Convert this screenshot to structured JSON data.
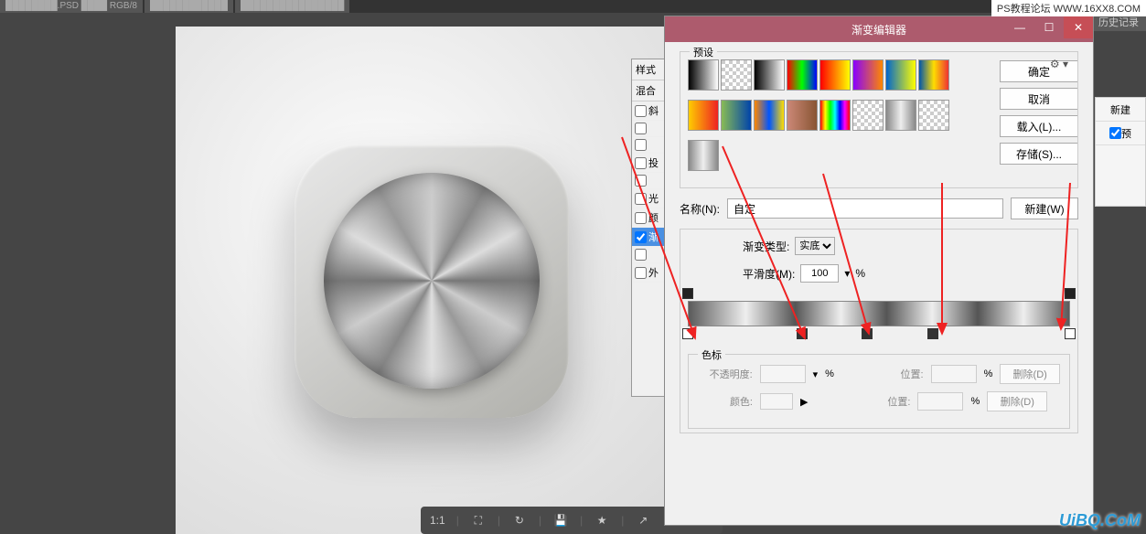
{
  "watermark_top": "PS教程论坛  WWW.16XX8.COM",
  "brand_watermark": "UiBQ.CoM",
  "history_tab": "历史记录",
  "swatch_colors": [
    "#b52f2f",
    "#e83a9a",
    "#7dc93a"
  ],
  "styles_panel": {
    "hdr1": "样式",
    "hdr2": "混合",
    "items": [
      "斜",
      "",
      "",
      "投",
      "",
      "光",
      "颜",
      "渐",
      "",
      "外"
    ],
    "active_index": 7
  },
  "editor": {
    "title": "渐变编辑器",
    "presets_legend": "预设",
    "buttons": {
      "ok": "确定",
      "cancel": "取消",
      "load": "载入(L)...",
      "save": "存储(S)..."
    },
    "name_label": "名称(N):",
    "name_value": "自定",
    "new_btn": "新建(W)",
    "type_label": "渐变类型:",
    "type_value": "实底",
    "smooth_label": "平滑度(M):",
    "smooth_value": "100",
    "smooth_unit": "%",
    "color_stop": {
      "legend": "色标",
      "opacity_label": "不透明度:",
      "opacity_unit": "%",
      "position_label": "位置:",
      "position_unit": "%",
      "delete_btn": "删除(D)",
      "color_label": "颜色:"
    },
    "preset_styles": [
      "linear-gradient(90deg,#000,#fff)",
      "repeating-conic-gradient(#ccc 0 25%,#fff 0 50%) 0/8px 8px",
      "linear-gradient(90deg,#000,#fff)",
      "linear-gradient(90deg,#f00,#0f0,#00f)",
      "linear-gradient(90deg,#f00,#ff0)",
      "linear-gradient(90deg,#80f,#f80)",
      "linear-gradient(90deg,#06c,#ff0)",
      "linear-gradient(90deg,#05a,#fd0,#e33)",
      "linear-gradient(90deg,#fc0,#e22)",
      "linear-gradient(90deg,#8b5,#04a)",
      "linear-gradient(90deg,#f80,#05f,#fd0)",
      "linear-gradient(90deg,#c87,#853)",
      "linear-gradient(90deg,#f00,#ff0,#0f0,#0ff,#00f,#f0f,#f00)",
      "repeating-conic-gradient(#ccc 0 25%,#fff 0 50%) 0/8px 8px",
      "linear-gradient(90deg,#888,#eee,#888)",
      "repeating-conic-gradient(#ccc 0 25%,#fff 0 50%) 0/8px 8px",
      "linear-gradient(90deg,#888,#eee,#888)"
    ],
    "opacity_stops": [
      0,
      100
    ],
    "color_stops": [
      {
        "pos": 0,
        "filled": false
      },
      {
        "pos": 30,
        "filled": true
      },
      {
        "pos": 47,
        "filled": true
      },
      {
        "pos": 64,
        "filled": true
      },
      {
        "pos": 100,
        "filled": false
      }
    ]
  },
  "right_panel": {
    "new_btn": "新建",
    "checkbox_label": "预"
  },
  "statusbar": {
    "zoom": "1:1"
  }
}
